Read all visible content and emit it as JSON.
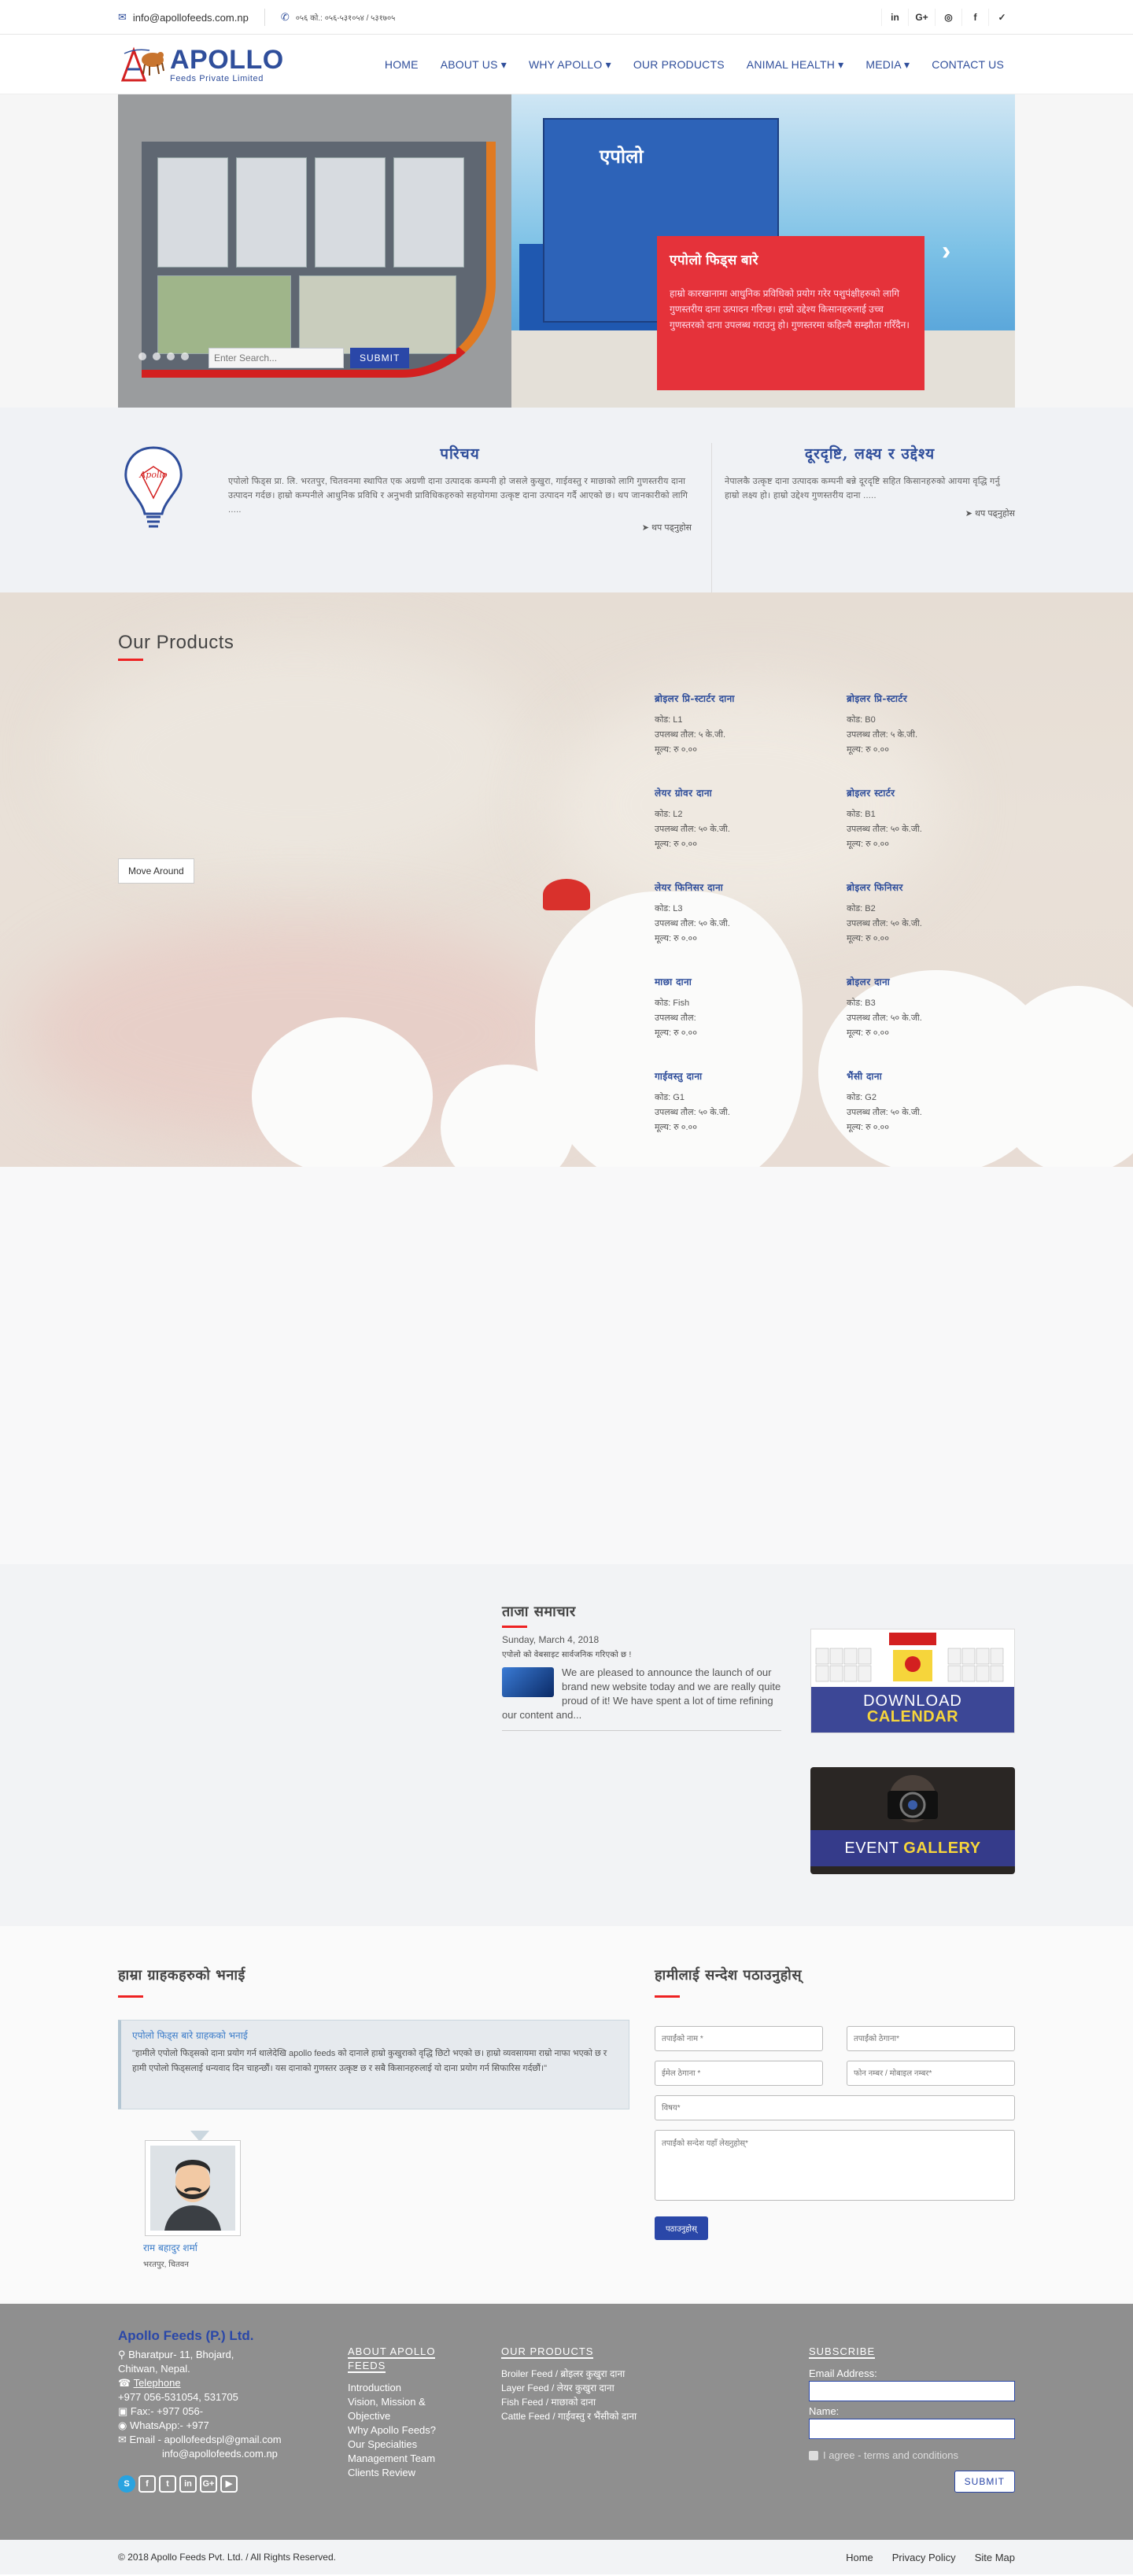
{
  "topbar": {
    "email": "info@apollofeeds.com.np",
    "phone": "०५६ को.: ०५६-५३१०५४ / ५३१७०५",
    "social_icons": [
      "linkedin-icon",
      "google-plus-icon",
      "instagram-icon",
      "facebook-icon",
      "twitter-icon"
    ],
    "social_glyphs": [
      "in",
      "G+",
      "◎",
      "f",
      "✓"
    ]
  },
  "header": {
    "logo_title": "APOLLO",
    "logo_subtitle": "Feeds Private Limited",
    "nav": [
      "HOME",
      "ABOUT US ▾",
      "WHY APOLLO ▾",
      "OUR PRODUCTS",
      "ANIMAL HEALTH ▾",
      "MEDIA ▾",
      "CONTACT US"
    ]
  },
  "hero": {
    "tower_label": "एपोलो",
    "caption_title": "एपोलो फिड्स बारे",
    "caption_text": "हाम्रो कारखानामा आधुनिक प्रविधिको प्रयोग गरेर पशुपंक्षीहरुको लागि गुणस्तरीय दाना उत्पादन गरिन्छ। हाम्रो उद्देश्य किसानहरुलाई उच्च गुणस्तरको दाना उपलब्ध गराउनु हो। गुणस्तरमा कहिल्यै सम्झौता गरिँदैन।",
    "search_placeholder": "Enter Search...",
    "search_button": "SUBMIT"
  },
  "about": {
    "left_title": "परिचय",
    "left_text": "एपोलो फिड्स प्रा. लि. भरतपुर, चितवनमा स्थापित एक अग्रणी दाना उत्पादक कम्पनी हो जसले कुखुरा, गाईवस्तु र माछाको लागि गुणस्तरीय दाना उत्पादन गर्दछ। हाम्रो कम्पनीले आधुनिक प्रविधि र अनुभवी प्राविधिकहरुको सहयोगमा उत्कृष्ट दाना उत्पादन गर्दै आएको छ। थप जानकारीको लागि .....",
    "left_more": "➤ थप पढ्नुहोस",
    "right_title": "दूरदृष्टि, लक्ष्य र उद्देश्य",
    "right_text": "नेपालकै उत्कृष्ट दाना उत्पादक कम्पनी बन्ने दूरदृष्टि सहित किसानहरुको आयमा वृद्धि गर्नु हाम्रो लक्ष्य हो। हाम्रो उद्देश्य गुणस्तरीय दाना .....",
    "right_more": "➤ थप पढ्नुहोस"
  },
  "products": {
    "title": "Our Products",
    "move_button": "Move Around",
    "items": [
      {
        "name": "ब्रोइलर प्रि-स्टार्टर दाना",
        "code": "कोड: L1",
        "weight": "उपलब्ध तौल: ५ के.जी.",
        "price": "मूल्य: रु ०.००"
      },
      {
        "name": "ब्रोइलर प्रि-स्टार्टर",
        "code": "कोड: B0",
        "weight": "उपलब्ध तौल: ५ के.जी.",
        "price": "मूल्य: रु ०.००"
      },
      {
        "name": "लेयर ग्रोवर दाना",
        "code": "कोड: L2",
        "weight": "उपलब्ध तौल: ५० के.जी.",
        "price": "मूल्य: रु ०.००"
      },
      {
        "name": "ब्रोइलर स्टार्टर",
        "code": "कोड: B1",
        "weight": "उपलब्ध तौल: ५० के.जी.",
        "price": "मूल्य: रु ०.००"
      },
      {
        "name": "लेयर फिनिसर दाना",
        "code": "कोड: L3",
        "weight": "उपलब्ध तौल: ५० के.जी.",
        "price": "मूल्य: रु ०.००"
      },
      {
        "name": "ब्रोइलर फिनिसर",
        "code": "कोड: B2",
        "weight": "उपलब्ध तौल: ५० के.जी.",
        "price": "मूल्य: रु ०.००"
      },
      {
        "name": "माछा दाना",
        "code": "कोड: Fish",
        "weight": "उपलब्ध तौल:",
        "price": "मूल्य: रु ०.००"
      },
      {
        "name": "ब्रोइलर दाना",
        "code": "कोड: B3",
        "weight": "उपलब्ध तौल: ५० के.जी.",
        "price": "मूल्य: रु ०.००"
      },
      {
        "name": "गाईवस्तु दाना",
        "code": "कोड: G1",
        "weight": "उपलब्ध तौल: ५० के.जी.",
        "price": "मूल्य: रु ०.००"
      },
      {
        "name": "भैंसी दाना",
        "code": "कोड: G2",
        "weight": "उपलब्ध तौल: ५० के.जी.",
        "price": "मूल्य: रु ०.००"
      }
    ]
  },
  "news": {
    "title": "ताजा समाचार",
    "date": "Sunday, March 4, 2018",
    "subtitle": "एपोलो को वेबसाइट सार्वजनिक गरिएको छ !",
    "body": "We are pleased to announce the launch of our brand new website today and we are really quite proud of it! We have spent a lot of time refining our content and..."
  },
  "calendar": {
    "line1": "DOWNLOAD",
    "line2": "CALENDAR"
  },
  "gallery": {
    "line1": "EVENT",
    "line2": "GALLERY"
  },
  "testimonials": {
    "title": "हाम्रा ग्राहकहरुको भनाई",
    "quote_title": "एपोलो फिड्स बारे ग्राहकको भनाई",
    "quote_text": "\"हामीले एपोलो फिड्सको दाना प्रयोग गर्न थालेदेखि apollo feeds को दानाले हाम्रो कुखुराको वृद्धि छिटो भएको छ। हाम्रो व्यवसायमा राम्रो नाफा भएको छ र हामी एपोलो फिड्सलाई धन्यवाद दिन चाहन्छौं। यस दानाको गुणस्तर उत्कृष्ट छ र सबै किसानहरुलाई यो दाना प्रयोग गर्न सिफारिस गर्दछौं।\"",
    "person_name": "राम बहादुर शर्मा",
    "person_location": "भरतपुर, चितवन"
  },
  "contact_form": {
    "title": "हामीलाई सन्देश पठाउनुहोस्",
    "name_placeholder": "तपाईंको नाम *",
    "address_placeholder": "तपाईंको ठेगाना*",
    "email_placeholder": "ईमेल ठेगाना *",
    "phone_placeholder": "फोन नम्बर / मोबाइल नम्बर*",
    "subject_placeholder": "विषय*",
    "message_placeholder": "तपाईंको सन्देश यहाँ लेख्नुहोस्*",
    "send_button": "पठाउनुहोस्"
  },
  "footer": {
    "company": "Apollo Feeds (P.) Ltd.",
    "address1": "Bharatpur- 11, Bhojard,",
    "address2": "Chitwan, Nepal.",
    "telephone_label": "Telephone",
    "telephone": "+977 056-531054, 531705",
    "fax": "Fax:- +977 056-",
    "whatsapp": "WhatsApp:- +977",
    "email1": "Email - apollofeedspl@gmail.com",
    "email2": "info@apollofeeds.com.np",
    "social": [
      "skype-icon",
      "facebook-icon",
      "twitter-icon",
      "linkedin-icon",
      "google-plus-icon",
      "youtube-icon"
    ],
    "social_glyphs": [
      "S",
      "f",
      "t",
      "in",
      "G+",
      "▶"
    ],
    "about_heading_1": "ABOUT APOLLO",
    "about_heading_2": "FEEDS",
    "about_links": [
      "Introduction",
      "Vision, Mission &",
      "Objective",
      "Why Apollo Feeds?",
      "Our Specialties",
      "Management Team",
      "Clients Review"
    ],
    "products_heading": "OUR PRODUCTS",
    "product_links": [
      "Broiler Feed / ब्रोइलर कुखुरा दाना",
      "Layer Feed / लेयर कुखुरा दाना",
      "Fish Feed / माछाको दाना",
      "Cattle Feed / गाईवस्तु र भैंसीको दाना"
    ],
    "subscribe_heading": "SUBSCRIBE",
    "email_label": "Email Address:",
    "name_label": "Name:",
    "agree": "I agree - terms and conditions",
    "submit": "SUBMIT"
  },
  "copyright": {
    "text": "© 2018 Apollo Feeds Pvt. Ltd. / All Rights Reserved.",
    "links": [
      "Home",
      "Privacy Policy",
      "Site Map"
    ]
  }
}
